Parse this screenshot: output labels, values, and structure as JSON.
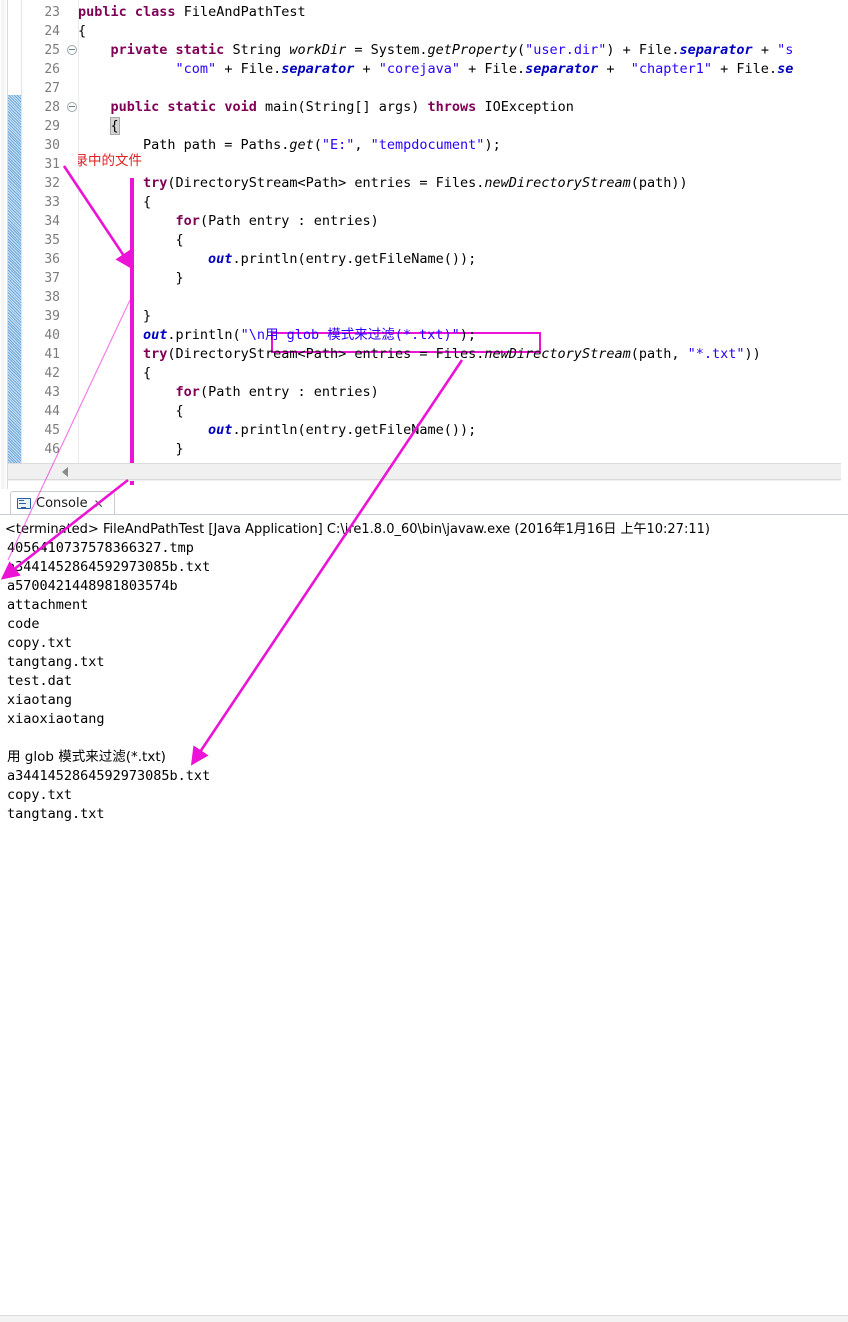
{
  "editor": {
    "first_line": 23,
    "lines": [
      {
        "n": 23,
        "fold": false,
        "indent": 0,
        "segments": [
          {
            "t": "public ",
            "c": "kw"
          },
          {
            "t": "class ",
            "c": "kw"
          },
          {
            "t": "FileAndPathTest",
            "c": "plain"
          }
        ]
      },
      {
        "n": 24,
        "fold": false,
        "indent": 0,
        "segments": [
          {
            "t": "{",
            "c": "plain"
          }
        ]
      },
      {
        "n": 25,
        "fold": true,
        "indent": 0,
        "segments": [
          {
            "t": "    ",
            "c": "plain"
          },
          {
            "t": "private ",
            "c": "kw"
          },
          {
            "t": "static ",
            "c": "kw"
          },
          {
            "t": "String ",
            "c": "plain"
          },
          {
            "t": "workDir",
            "c": "stat"
          },
          {
            "t": " = System.",
            "c": "plain"
          },
          {
            "t": "getProperty",
            "c": "stat"
          },
          {
            "t": "(",
            "c": "plain"
          },
          {
            "t": "\"user.dir\"",
            "c": "str"
          },
          {
            "t": ") + File.",
            "c": "plain"
          },
          {
            "t": "separator",
            "c": "fld"
          },
          {
            "t": " + ",
            "c": "plain"
          },
          {
            "t": "\"s",
            "c": "str"
          }
        ]
      },
      {
        "n": 26,
        "fold": false,
        "indent": 0,
        "segments": [
          {
            "t": "            ",
            "c": "plain"
          },
          {
            "t": "\"com\"",
            "c": "str"
          },
          {
            "t": " + File.",
            "c": "plain"
          },
          {
            "t": "separator",
            "c": "fld"
          },
          {
            "t": " + ",
            "c": "plain"
          },
          {
            "t": "\"corejava\"",
            "c": "str"
          },
          {
            "t": " + File.",
            "c": "plain"
          },
          {
            "t": "separator",
            "c": "fld"
          },
          {
            "t": " +  ",
            "c": "plain"
          },
          {
            "t": "\"chapter1\"",
            "c": "str"
          },
          {
            "t": " + File.",
            "c": "plain"
          },
          {
            "t": "se",
            "c": "fld"
          }
        ]
      },
      {
        "n": 27,
        "fold": false,
        "indent": 0,
        "segments": []
      },
      {
        "n": 28,
        "fold": true,
        "indent": 0,
        "segments": [
          {
            "t": "    ",
            "c": "plain"
          },
          {
            "t": "public ",
            "c": "kw"
          },
          {
            "t": "static ",
            "c": "kw"
          },
          {
            "t": "void ",
            "c": "kw"
          },
          {
            "t": "main(String[] args) ",
            "c": "plain"
          },
          {
            "t": "throws ",
            "c": "kw"
          },
          {
            "t": "IOException",
            "c": "plain"
          }
        ]
      },
      {
        "n": 29,
        "fold": false,
        "indent": 0,
        "segments": [
          {
            "t": "    ",
            "c": "plain"
          },
          {
            "t": "{",
            "c": "brace-hl"
          }
        ]
      },
      {
        "n": 30,
        "fold": false,
        "indent": 0,
        "segments": [
          {
            "t": "        Path path = Paths.",
            "c": "plain"
          },
          {
            "t": "get",
            "c": "stat"
          },
          {
            "t": "(",
            "c": "plain"
          },
          {
            "t": "\"E:\"",
            "c": "str"
          },
          {
            "t": ", ",
            "c": "plain"
          },
          {
            "t": "\"tempdocument\"",
            "c": "str"
          },
          {
            "t": ");",
            "c": "plain"
          }
        ]
      },
      {
        "n": 31,
        "fold": false,
        "indent": 0,
        "segments": []
      },
      {
        "n": 32,
        "fold": false,
        "indent": 0,
        "segments": [
          {
            "t": "        ",
            "c": "plain"
          },
          {
            "t": "try",
            "c": "kw"
          },
          {
            "t": "(DirectoryStream<Path> entries = Files.",
            "c": "plain"
          },
          {
            "t": "newDirectoryStream",
            "c": "stat"
          },
          {
            "t": "(path))",
            "c": "plain"
          }
        ]
      },
      {
        "n": 33,
        "fold": false,
        "indent": 0,
        "segments": [
          {
            "t": "        {",
            "c": "plain"
          }
        ]
      },
      {
        "n": 34,
        "fold": false,
        "indent": 0,
        "segments": [
          {
            "t": "            ",
            "c": "plain"
          },
          {
            "t": "for",
            "c": "kw"
          },
          {
            "t": "(Path entry : entries)",
            "c": "plain"
          }
        ]
      },
      {
        "n": 35,
        "fold": false,
        "indent": 0,
        "segments": [
          {
            "t": "            {",
            "c": "plain"
          }
        ]
      },
      {
        "n": 36,
        "fold": false,
        "indent": 0,
        "segments": [
          {
            "t": "                ",
            "c": "plain"
          },
          {
            "t": "out",
            "c": "statb"
          },
          {
            "t": ".println(entry.getFileName());",
            "c": "plain"
          }
        ]
      },
      {
        "n": 37,
        "fold": false,
        "indent": 0,
        "segments": [
          {
            "t": "            }",
            "c": "plain"
          }
        ]
      },
      {
        "n": 38,
        "fold": false,
        "indent": 0,
        "segments": []
      },
      {
        "n": 39,
        "fold": false,
        "indent": 0,
        "segments": [
          {
            "t": "        }",
            "c": "plain"
          }
        ]
      },
      {
        "n": 40,
        "fold": false,
        "indent": 0,
        "segments": [
          {
            "t": "        ",
            "c": "plain"
          },
          {
            "t": "out",
            "c": "statb"
          },
          {
            "t": ".println(",
            "c": "plain"
          },
          {
            "t": "\"\\n用 glob 模式来过滤(*.txt)\"",
            "c": "str"
          },
          {
            "t": ");",
            "c": "plain"
          }
        ]
      },
      {
        "n": 41,
        "fold": false,
        "indent": 0,
        "segments": [
          {
            "t": "        ",
            "c": "plain"
          },
          {
            "t": "try",
            "c": "kw"
          },
          {
            "t": "(DirectoryStream<Path> entries = Files.",
            "c": "plain"
          },
          {
            "t": "newDirectoryStream",
            "c": "stat"
          },
          {
            "t": "(path, ",
            "c": "plain"
          },
          {
            "t": "\"*.txt\"",
            "c": "str"
          },
          {
            "t": "))",
            "c": "plain"
          }
        ]
      },
      {
        "n": 42,
        "fold": false,
        "indent": 0,
        "segments": [
          {
            "t": "        {",
            "c": "plain"
          }
        ]
      },
      {
        "n": 43,
        "fold": false,
        "indent": 0,
        "segments": [
          {
            "t": "            ",
            "c": "plain"
          },
          {
            "t": "for",
            "c": "kw"
          },
          {
            "t": "(Path entry : entries)",
            "c": "plain"
          }
        ]
      },
      {
        "n": 44,
        "fold": false,
        "indent": 0,
        "segments": [
          {
            "t": "            {",
            "c": "plain"
          }
        ]
      },
      {
        "n": 45,
        "fold": false,
        "indent": 0,
        "segments": [
          {
            "t": "                ",
            "c": "plain"
          },
          {
            "t": "out",
            "c": "statb"
          },
          {
            "t": ".println(entry.getFileName());",
            "c": "plain"
          }
        ]
      },
      {
        "n": 46,
        "fold": false,
        "indent": 0,
        "segments": [
          {
            "t": "            }",
            "c": "plain"
          }
        ]
      }
    ],
    "annotation_note": "迭代目录中的文件",
    "annotation_note_line": 31,
    "highlight_box_text": "\"\\n用 glob 模式来过滤(*.txt)\"",
    "colors": {
      "keyword": "#7f0055",
      "string": "#2a00ff",
      "field": "#0000c0",
      "line_number": "#7c7c7c",
      "annotation": "#ec13d6",
      "note_red": "#e02020"
    }
  },
  "console": {
    "tab_label": "Console",
    "tab_close": "✕",
    "tab_icon": "console-icon",
    "status_line": "<terminated> FileAndPathTest [Java Application] C:\\jre1.8.0_60\\bin\\javaw.exe (2016年1月16日 上午10:27:11)",
    "output_lines": [
      "4056410737578366327.tmp",
      "a3441452864592973085b.txt",
      "a5700421448981803574b",
      "attachment",
      "code",
      "copy.txt",
      "tangtang.txt",
      "test.dat",
      "xiaotang",
      "xiaoxiaotang",
      "",
      "用 glob 模式来过滤(*.txt)",
      "a3441452864592973085b.txt",
      "copy.txt",
      "tangtang.txt"
    ],
    "cn_line_indices": [
      11
    ]
  },
  "annotations": {
    "arrow_color": "#ec13d6",
    "arrow1_label": "arrow-note-to-try-block",
    "arrow2_label": "arrow-try-block-to-console-output",
    "arrow3_label": "arrow-glob-string-to-console-glob-line",
    "vertical_bar_label": "try-block-bracket-bar"
  }
}
